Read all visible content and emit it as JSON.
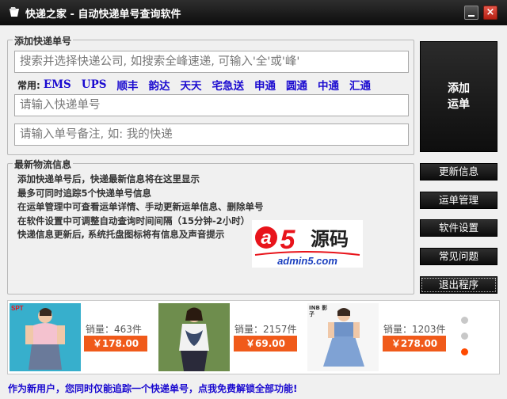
{
  "window": {
    "title": "快递之家 - 自动快递单号查询软件",
    "close_glyph": "×"
  },
  "add_group": {
    "title": "添加快递单号",
    "company_placeholder": "搜索并选择快递公司, 如搜索全峰速递, 可输入'全'或'峰'",
    "common_label": "常用:",
    "common_companies": [
      "EMS",
      "UPS",
      "顺丰",
      "韵达",
      "天天",
      "宅急送",
      "申通",
      "圆通",
      "中通",
      "汇通"
    ],
    "tracking_placeholder": "请输入快递单号",
    "note_placeholder": "请输入单号备注, 如: 我的快递",
    "add_button_line1": "添加",
    "add_button_line2": "运单"
  },
  "info_group": {
    "title": "最新物流信息",
    "lines": [
      "添加快递单号后，快递最新信息将在这里显示",
      "最多可同时追踪5个快递单号信息",
      "在运单管理中可查看运单详情、手动更新运单信息、删除单号",
      "在软件设置中可调整自动查询时间间隔（15分钟-2小时）",
      "快递信息更新后, 系统托盘图标将有信息及声音提示"
    ]
  },
  "watermark": {
    "brand_a": "a",
    "brand_5": "5",
    "brand_cn": "源码",
    "domain": "admin5.com"
  },
  "side_buttons": {
    "update": "更新信息",
    "orders": "运单管理",
    "settings": "软件设置",
    "faq": "常见问题",
    "exit": "退出程序"
  },
  "ads": {
    "products": [
      {
        "sales": "销量：463件",
        "price": "￥178.00",
        "brand": "SPT"
      },
      {
        "sales": "销量：2157件",
        "price": "￥69.00",
        "brand": ""
      },
      {
        "sales": "销量：1203件",
        "price": "￥278.00",
        "brand": "INB 影子"
      }
    ]
  },
  "footer": {
    "text": "作为新用户，您同时仅能追踪一个快递单号，点我免费解锁全部功能!"
  },
  "colors": {
    "accent_blue": "#1a0ad0",
    "price_orange": "#f05a1a",
    "dark_button": "#1a1a1a"
  }
}
